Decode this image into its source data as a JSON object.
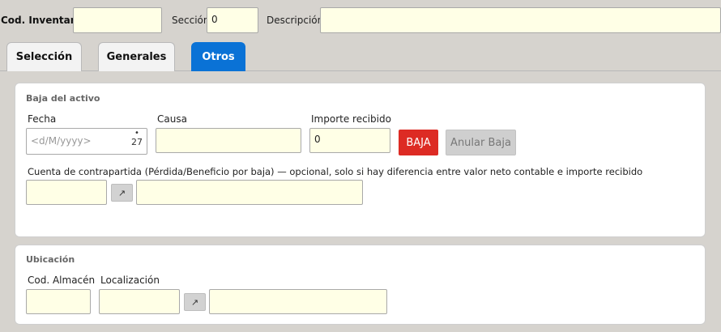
{
  "header": {
    "cod_inventario_label": "Cod. Inventario",
    "cod_inventario_value": "",
    "seccion_label": "Sección",
    "seccion_value": "0",
    "descripcion_label": "Descripción",
    "descripcion_value": ""
  },
  "tabs": [
    {
      "label": "Selección",
      "active": false
    },
    {
      "label": "Generales",
      "active": false
    },
    {
      "label": "Otros",
      "active": true
    }
  ],
  "baja": {
    "title": "Baja del activo",
    "fecha_label": "Fecha",
    "fecha_placeholder": "<d/M/yyyy>",
    "calendar_dot": "•",
    "calendar_day": "27",
    "causa_label": "Causa",
    "causa_value": "",
    "importe_label": "Importe recibido",
    "importe_value": "0",
    "baja_button": "BAJA",
    "anular_button": "Anular Baja",
    "cuenta_label": "Cuenta de contrapartida (Pérdida/Beneficio por baja) — opcional, solo si hay diferencia entre valor neto contable e importe recibido",
    "cuenta_code": "",
    "cuenta_desc": "",
    "link_glyph": "↗"
  },
  "ubicacion": {
    "title": "Ubicación",
    "almacen_label": "Cod. Almacén",
    "almacen_value": "",
    "localizacion_label": "Localización",
    "localizacion_code": "",
    "localizacion_desc": "",
    "link_glyph": "↗"
  },
  "colors": {
    "background": "#d6d3ce",
    "input_bg": "#ffffe6",
    "tab_active": "#0a72d6",
    "baja_button": "#dd2b24"
  }
}
